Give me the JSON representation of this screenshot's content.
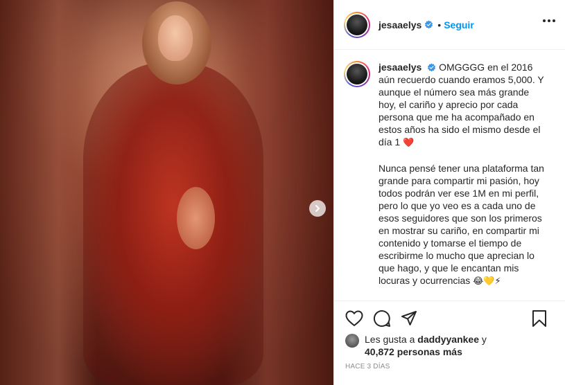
{
  "post": {
    "username": "jesaaelys",
    "follow_label": "Seguir",
    "separator": "•",
    "caption_para1": "OMGGGG en el 2016 aún recuerdo cuando eramos 5,000. Y aunque el número sea más grande hoy, el cariño y aprecio por cada persona que me ha acompañado en estos años ha sido el mismo desde el día 1",
    "caption_para1_emoji": "❤️",
    "caption_para2": "Nunca pensé tener una plataforma tan grande para compartir mi pasión, hoy todos podrán ver ese 1M en mi perfil, pero lo que yo veo es a cada uno de esos seguidores que son los primeros en mostrar su cariño, en compartir mi contenido y tomarse el tiempo de escribirme lo mucho que aprecian lo que hago, y que le encantan mis locuras y ocurrencias",
    "caption_para2_emoji": "😂💛⚡",
    "likes_prefix": "Les gusta a",
    "likes_user": "daddyyankee",
    "likes_connector": "y",
    "likes_count": "40,872 personas más",
    "timestamp": "Hace 3 días"
  },
  "icons": {
    "verified": "verified-badge-icon",
    "more": "more-options-icon",
    "next": "chevron-right-icon",
    "like": "heart-icon",
    "comment": "comment-icon",
    "share": "paper-plane-icon",
    "save": "bookmark-icon"
  },
  "colors": {
    "accent": "#0095f6",
    "text": "#262626",
    "muted": "#8e8e8e",
    "heart": "#ed4956"
  }
}
